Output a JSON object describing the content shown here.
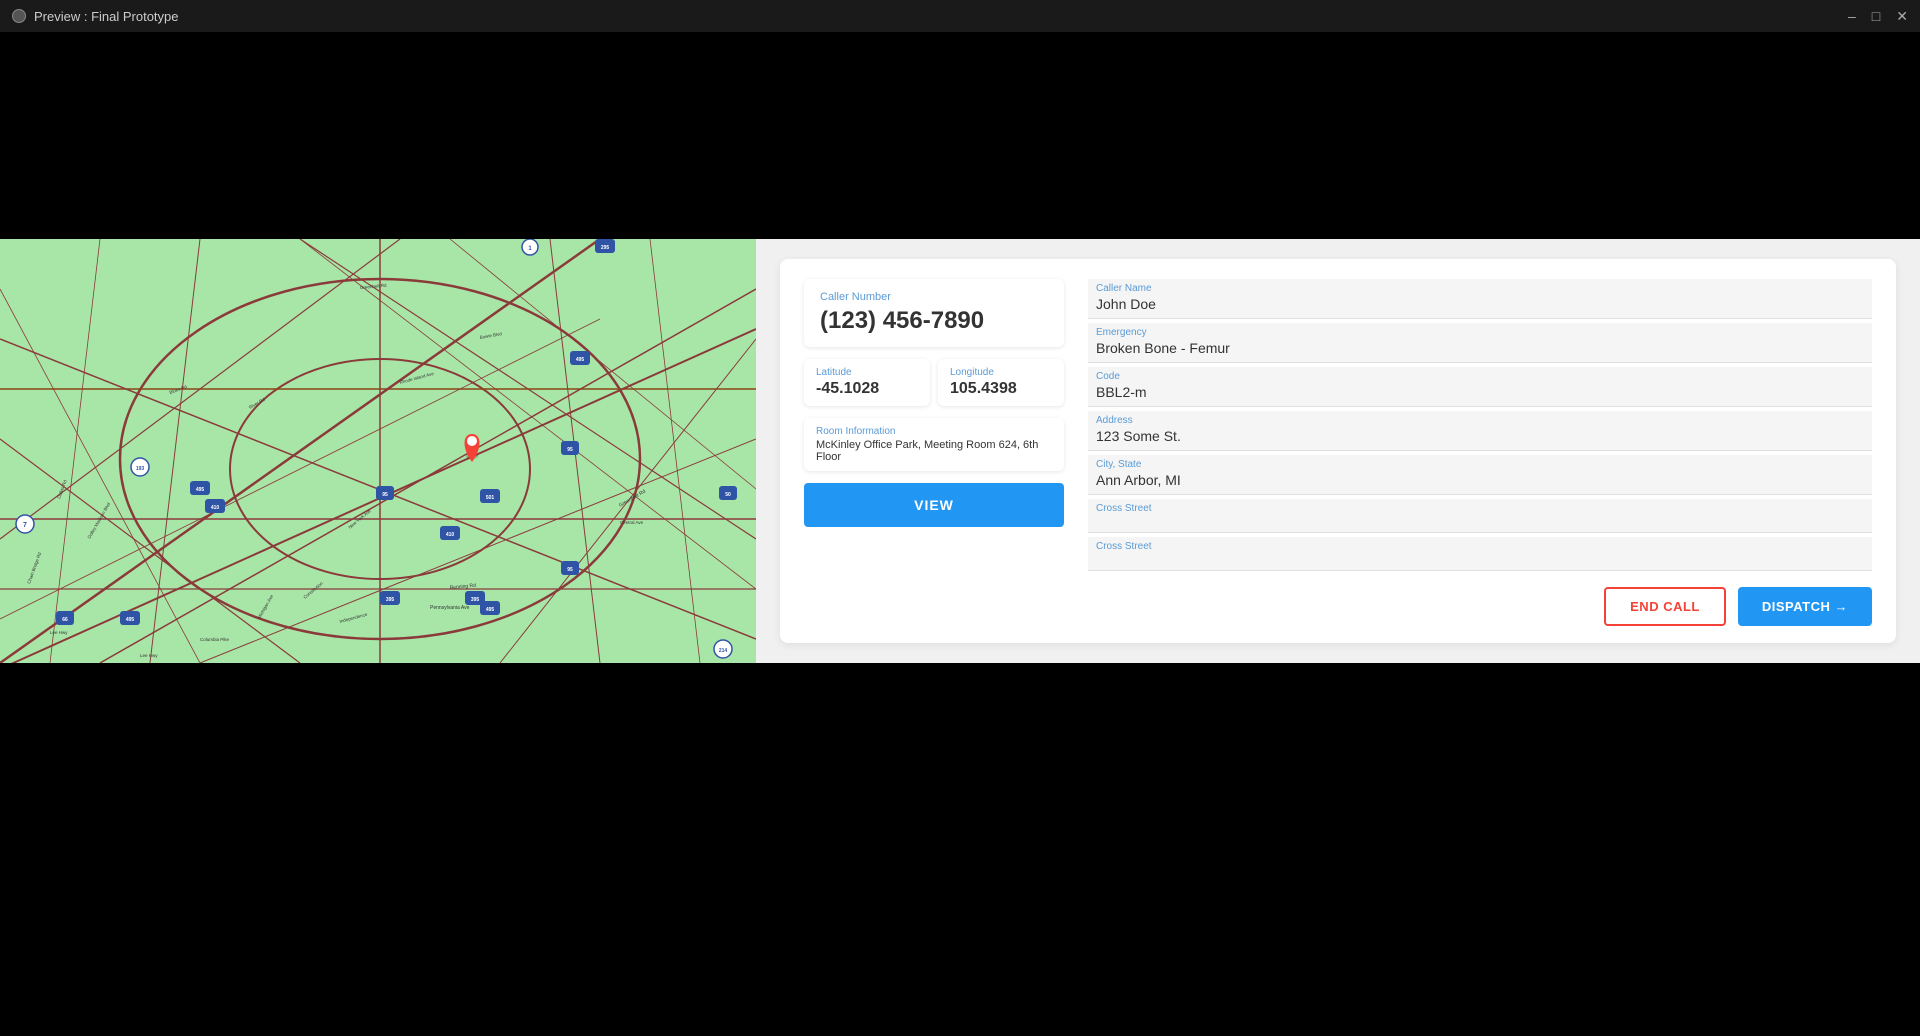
{
  "titleBar": {
    "title": "Preview : Final Prototype",
    "controls": [
      "minimize",
      "maximize",
      "close"
    ]
  },
  "callerPanel": {
    "callerNumberLabel": "Caller Number",
    "callerNumber": "(123) 456-7890",
    "latitudeLabel": "Latitude",
    "latitude": "-45.1028",
    "longitudeLabel": "Longitude",
    "longitude": "105.4398",
    "roomInfoLabel": "Room Information",
    "roomInfo": "McKinley Office Park, Meeting Room 624, 6th Floor",
    "viewButtonLabel": "VIEW"
  },
  "detailsPanel": {
    "callerNameLabel": "Caller Name",
    "callerName": "John Doe",
    "emergencyLabel": "Emergency",
    "emergency": "Broken Bone - Femur",
    "codeLabel": "Code",
    "code": "BBL2-m",
    "addressLabel": "Address",
    "address": "123 Some St.",
    "cityStateLabel": "City, State",
    "cityState": "Ann Arbor, MI",
    "crossStreet1Label": "Cross Street",
    "crossStreet1": "",
    "crossStreet2Label": "Cross Street",
    "crossStreet2": ""
  },
  "actionButtons": {
    "endCall": "END CALL",
    "dispatch": "DISPATCH →"
  }
}
